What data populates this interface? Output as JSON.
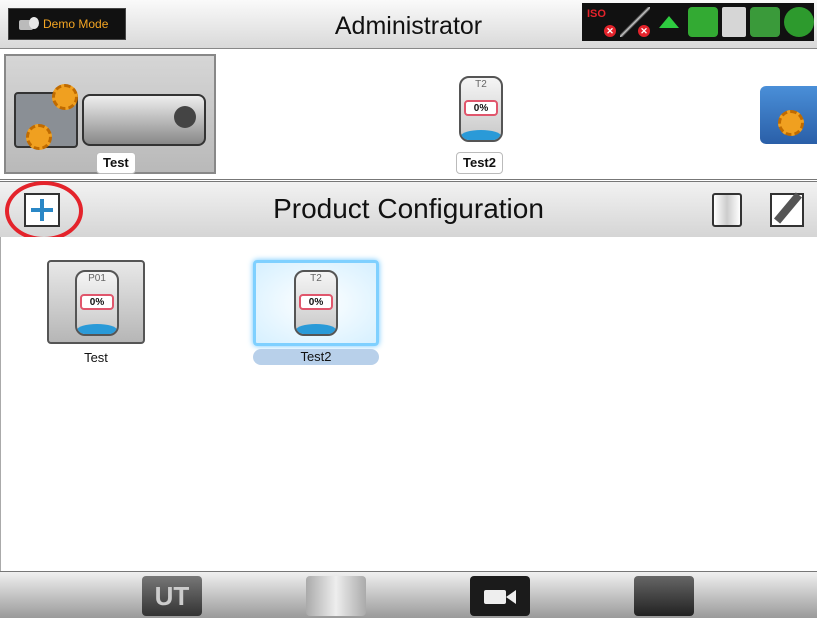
{
  "header": {
    "demo_label": "Demo Mode",
    "title": "Administrator",
    "status_icons": [
      "iso-icon",
      "guidance-icon",
      "up-arrow-icon",
      "satellite-icon",
      "document-icon",
      "terminal-icon",
      "connection-icon"
    ],
    "iso_label": "ISO"
  },
  "machine_strip": {
    "machine_label": "Test",
    "tank_name": "T2",
    "tank_percent": "0%",
    "tank_label": "Test2"
  },
  "product_bar": {
    "title": "Product Configuration"
  },
  "products": [
    {
      "tank_name": "P01",
      "percent": "0%",
      "label": "Test",
      "selected": false
    },
    {
      "tank_name": "T2",
      "percent": "0%",
      "label": "Test2",
      "selected": true
    }
  ],
  "bottom_nav": {
    "ut_label": "UT",
    "items": [
      "ut-icon",
      "map-icon",
      "camera-icon",
      "machine-icon"
    ]
  },
  "colors": {
    "accent_blue": "#2a87c6",
    "highlight": "#e4232b",
    "demo_text": "#f5a623"
  }
}
